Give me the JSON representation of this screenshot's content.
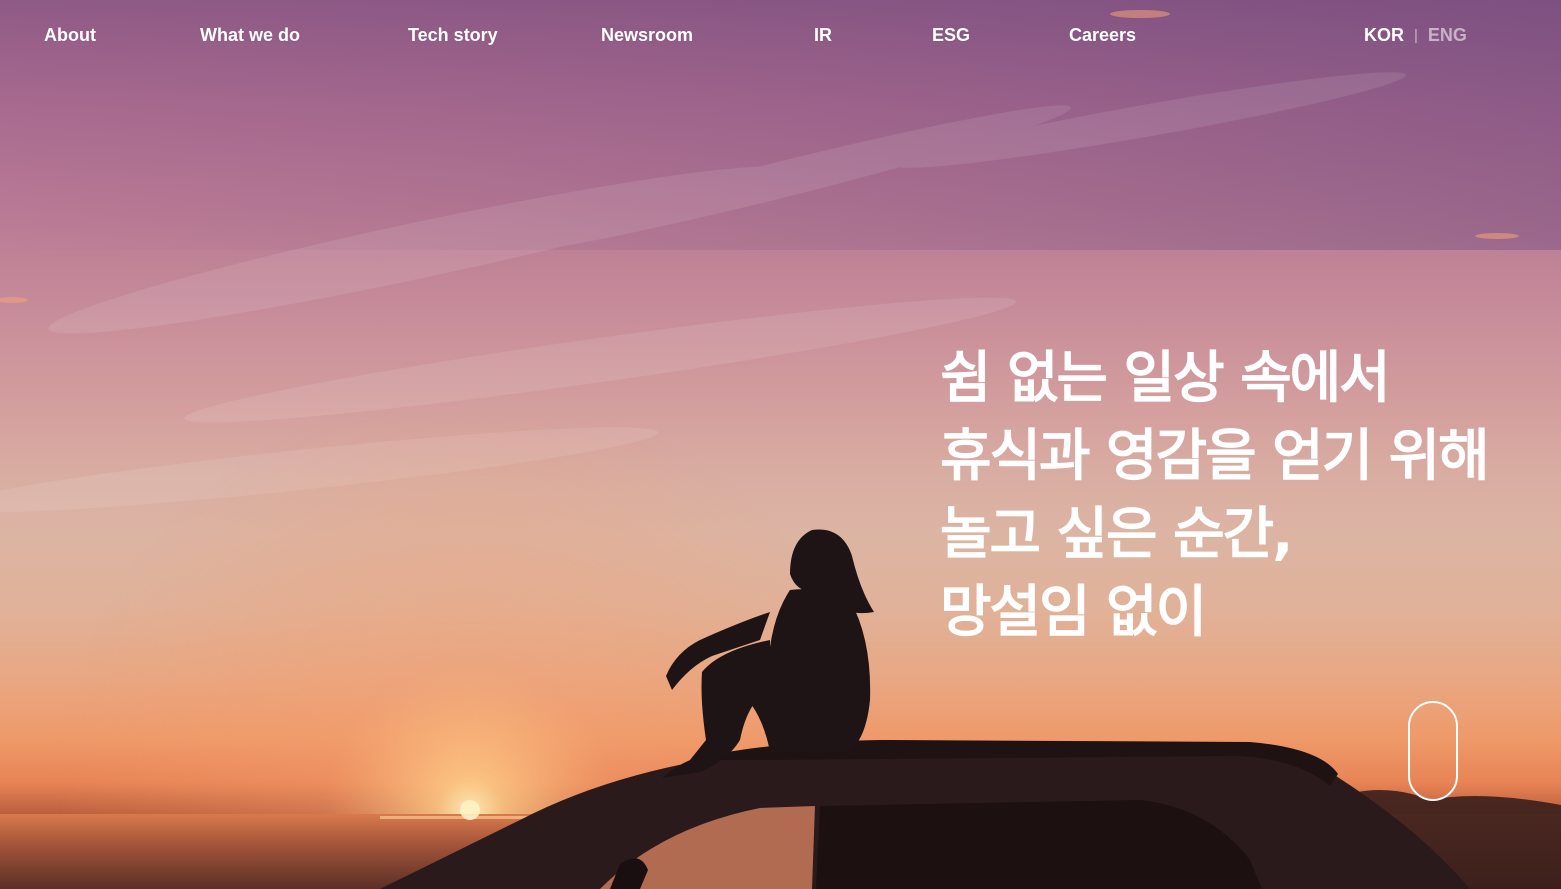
{
  "nav": {
    "items": [
      {
        "label": "About"
      },
      {
        "label": "What we do"
      },
      {
        "label": "Tech story"
      },
      {
        "label": "Newsroom"
      },
      {
        "label": "IR"
      },
      {
        "label": "ESG"
      },
      {
        "label": "Careers"
      }
    ]
  },
  "language": {
    "kor": "KOR",
    "separator": "|",
    "eng": "ENG",
    "active": "KOR"
  },
  "hero": {
    "lines": [
      "쉼 없는 일상 속에서",
      "휴식과 영감을 얻기 위해",
      "놀고 싶은 순간,",
      "망설임 없이"
    ],
    "image": "sunset-silhouette-on-car-roof"
  },
  "colors": {
    "text": "#ffffff",
    "inactive_lang": "#ffffff8c",
    "sky_top": "#8e5a86",
    "sky_horizon": "#ef9a6a"
  }
}
